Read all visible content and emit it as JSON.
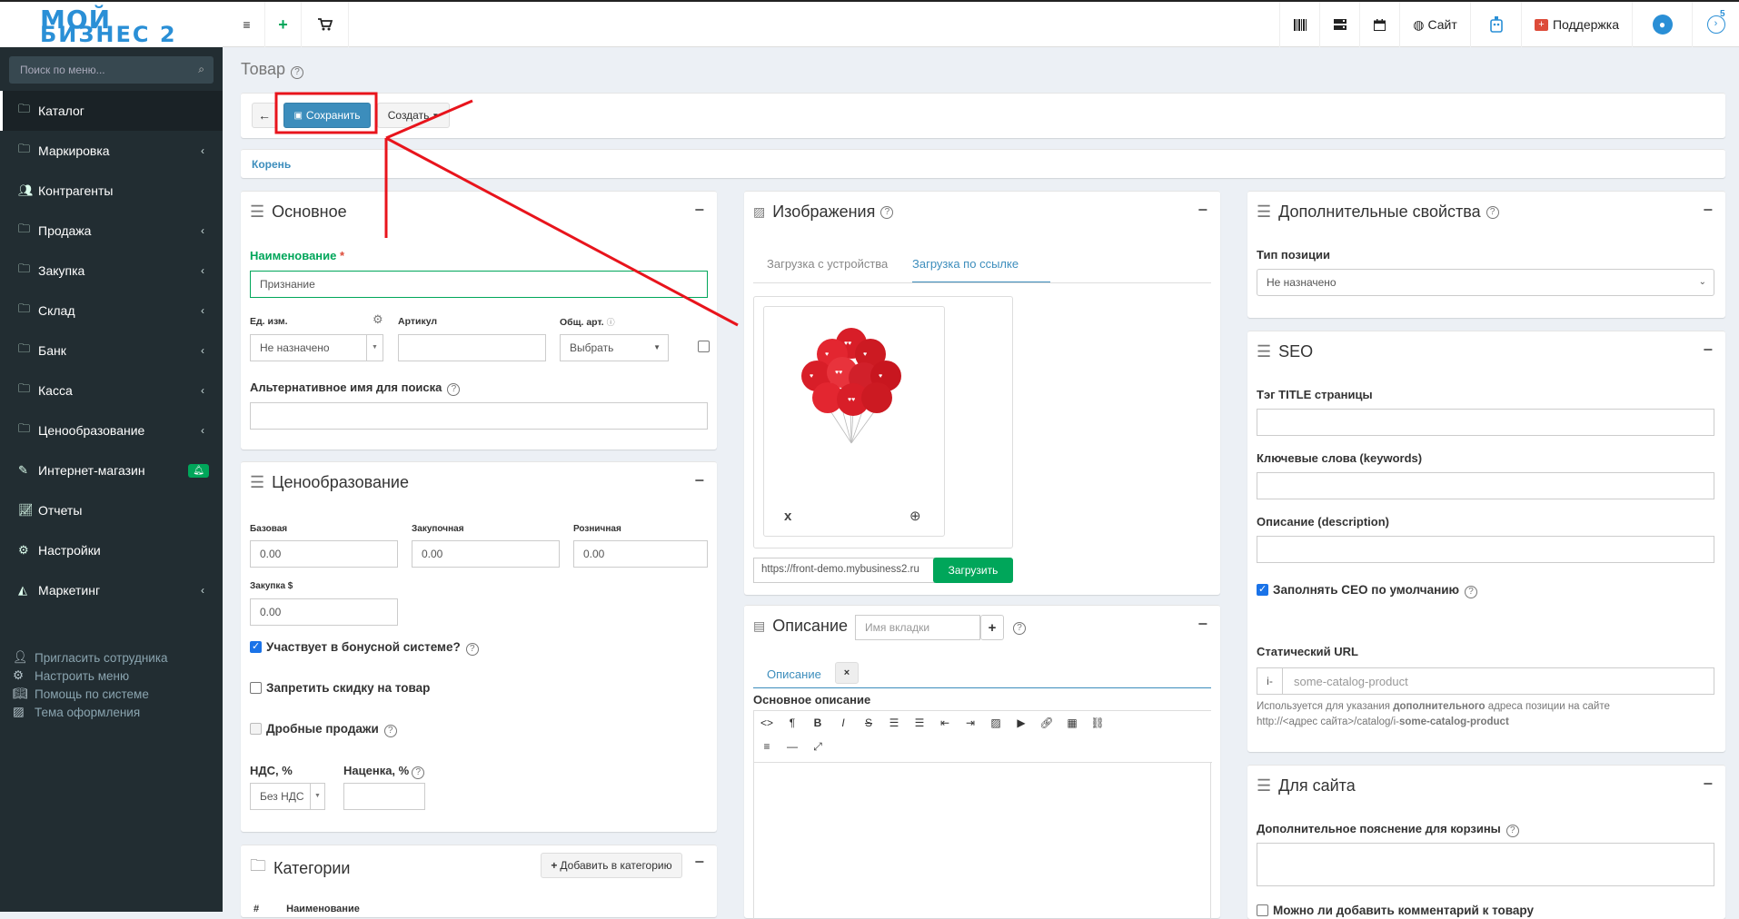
{
  "logo": {
    "line1": "МОЙ",
    "line2": "БИЗНЕС 2"
  },
  "topbar": {
    "site_label": "Сайт",
    "support_label": "Поддержка",
    "notif_count": "5"
  },
  "sidebar": {
    "search_placeholder": "Поиск по меню...",
    "items": [
      {
        "label": "Каталог",
        "icon": "folder-icon",
        "chev": false
      },
      {
        "label": "Маркировка",
        "icon": "folder-icon",
        "chev": true
      },
      {
        "label": "Контрагенты",
        "icon": "users-icon",
        "chev": false
      },
      {
        "label": "Продажа",
        "icon": "folder-icon",
        "chev": true
      },
      {
        "label": "Закупка",
        "icon": "folder-icon",
        "chev": true
      },
      {
        "label": "Склад",
        "icon": "folder-icon",
        "chev": true
      },
      {
        "label": "Банк",
        "icon": "folder-icon",
        "chev": true
      },
      {
        "label": "Касса",
        "icon": "folder-icon",
        "chev": true
      },
      {
        "label": "Ценообразование",
        "icon": "folder-icon",
        "chev": true
      },
      {
        "label": "Интернет-магазин",
        "icon": "wand-icon",
        "chev": false
      },
      {
        "label": "Отчеты",
        "icon": "chart-icon",
        "chev": false
      },
      {
        "label": "Настройки",
        "icon": "gear-icon",
        "chev": false
      },
      {
        "label": "Маркетинг",
        "icon": "chart-area-icon",
        "chev": true
      }
    ],
    "footer": [
      {
        "label": "Пригласить сотрудника",
        "icon": "user-plus-icon"
      },
      {
        "label": "Настроить меню",
        "icon": "gears-icon"
      },
      {
        "label": "Помощь по системе",
        "icon": "book-icon"
      },
      {
        "label": "Тема оформления",
        "icon": "image-icon"
      }
    ]
  },
  "page": {
    "title": "Товар"
  },
  "toolbar": {
    "save_label": "Сохранить",
    "create_label": "Создать"
  },
  "breadcrumb": {
    "root": "Корень"
  },
  "basic": {
    "title": "Основное",
    "name_label": "Наименование",
    "name_value": "Признание",
    "unit_label": "Ед. изм.",
    "unit_value": "Не назначено",
    "article_label": "Артикул",
    "common_art_label": "Общ. арт.",
    "common_art_value": "Выбрать",
    "alt_name_label": "Альтернативное имя для поиска"
  },
  "pricing": {
    "title": "Ценообразование",
    "base_label": "Базовая",
    "base_value": "0.00",
    "purchase_label": "Закупочная",
    "purchase_value": "0.00",
    "retail_label": "Розничная",
    "retail_value": "0.00",
    "purchase_usd_label": "Закупка $",
    "purchase_usd_value": "0.00",
    "bonus_label": "Участвует в бонусной системе?",
    "no_discount_label": "Запретить скидку на товар",
    "fractional_label": "Дробные продажи",
    "vat_label": "НДС, %",
    "vat_value": "Без НДС",
    "markup_label": "Наценка, %"
  },
  "categories": {
    "title": "Категории",
    "add_label": "Добавить в категорию",
    "col_name": "Наименование"
  },
  "images": {
    "title": "Изображения",
    "tab_device": "Загрузка с устройства",
    "tab_url": "Загрузка по ссылке",
    "url_value": "https://front-demo.mybusiness2.ru",
    "upload_label": "Загрузить",
    "remove_label": "x"
  },
  "description": {
    "title": "Описание",
    "tab_placeholder": "Имя вкладки",
    "tab_name": "Описание",
    "main_label": "Основное описание"
  },
  "extra": {
    "title": "Дополнительные свойства",
    "type_label": "Тип позиции",
    "type_value": "Не назначено"
  },
  "seo": {
    "title": "SEO",
    "title_tag_label": "Тэг TITLE страницы",
    "keywords_label": "Ключевые слова (keywords)",
    "desc_label": "Описание (description)",
    "default_label": "Заполнять СЕО по умолчанию",
    "static_url_label": "Статический URL",
    "url_prefix": "i-",
    "url_value": "some-catalog-product",
    "hint1": "Используется для указания ",
    "hint1_bold": "дополнительного",
    "hint1_end": " адреса позиции на сайте",
    "hint2": "http://<адрес сайта>/catalog/i-",
    "hint2_bold": "some-catalog-product"
  },
  "for_site": {
    "title": "Для сайта",
    "cart_note_label": "Дополнительное пояснение для корзины",
    "comment_label": "Можно ли добавить комментарий к товару"
  },
  "colors": {
    "primary": "#3c8dbc",
    "success": "#00a65a",
    "sidebar": "#222d32",
    "annotation": "#e8141c"
  }
}
